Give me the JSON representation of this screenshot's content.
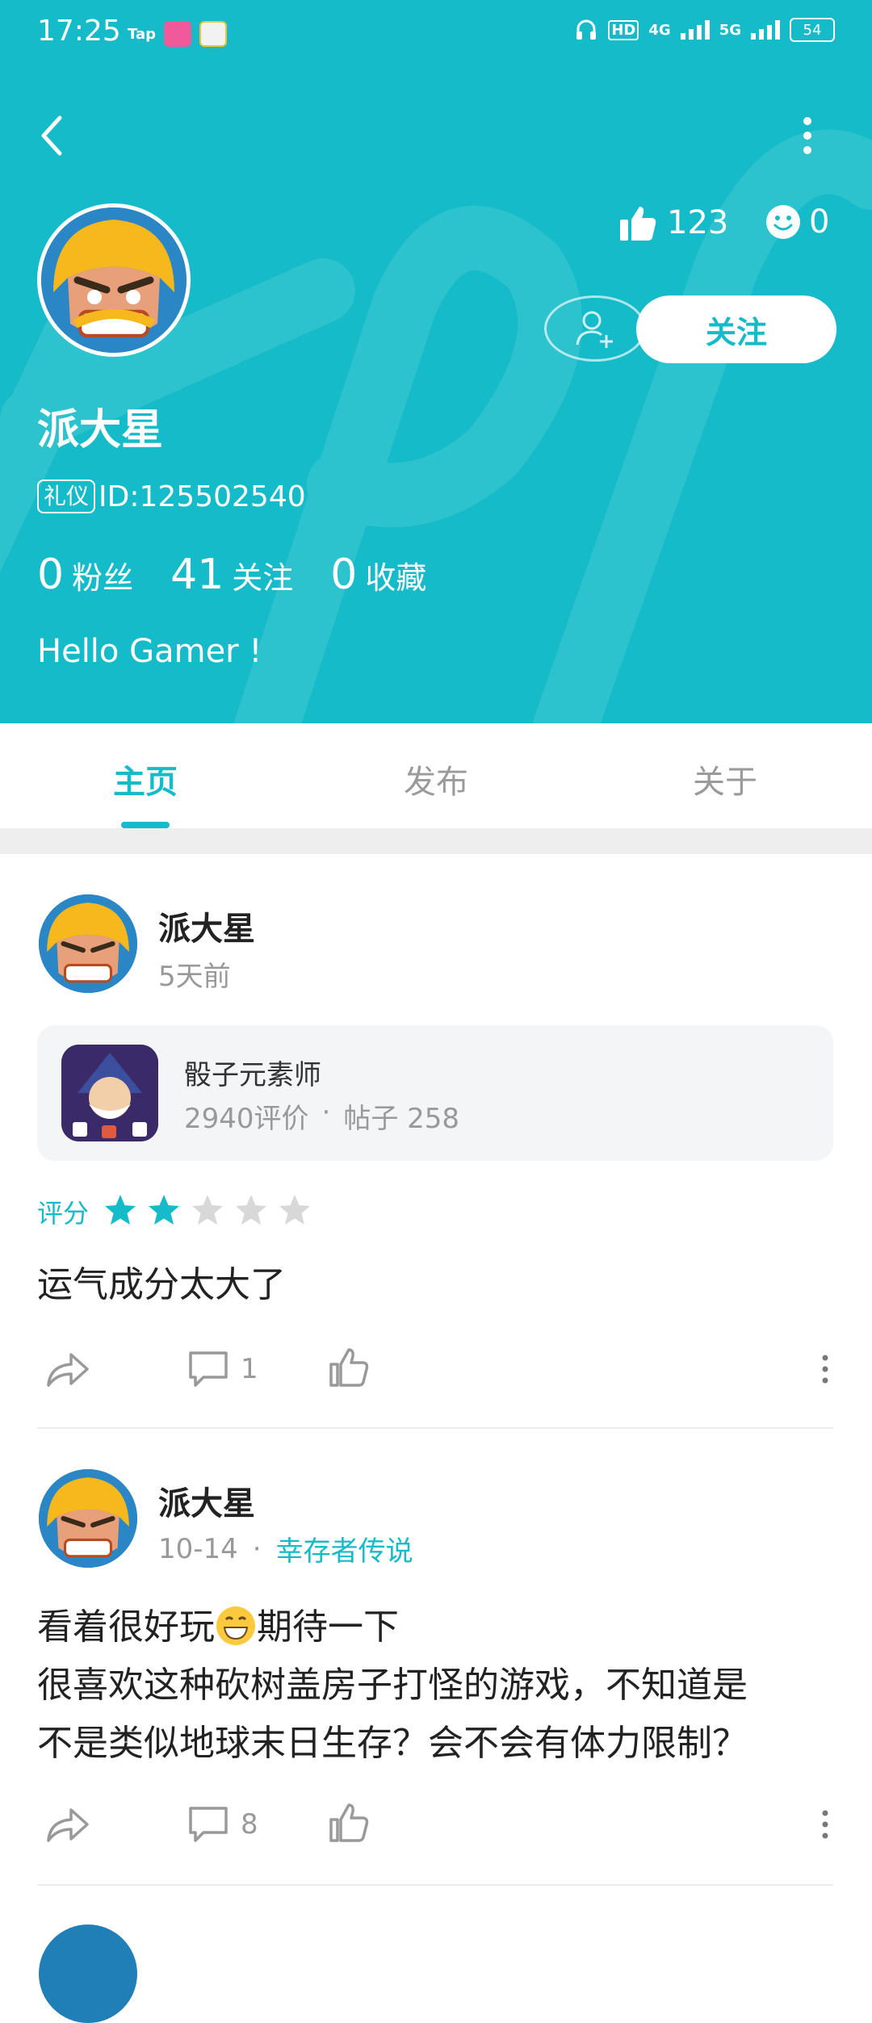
{
  "status_bar": {
    "time": "17:25",
    "app1": "Tap",
    "network_hd": "HD",
    "signal_4g": "4G",
    "signal_5g": "5G",
    "battery": "54"
  },
  "profile": {
    "likes": "123",
    "emoji_count": "0",
    "follow_label": "关注",
    "name": "派大星",
    "id_badge": "礼仪",
    "id_text": "ID:125502540",
    "fans_count": "0",
    "fans_label": "粉丝",
    "following_count": "41",
    "following_label": "关注",
    "favorites_count": "0",
    "favorites_label": "收藏",
    "bio": "Hello Gamer !"
  },
  "tabs": [
    {
      "label": "主页",
      "active": true
    },
    {
      "label": "发布",
      "active": false
    },
    {
      "label": "关于",
      "active": false
    }
  ],
  "posts": [
    {
      "author": "派大星",
      "time": "5天前",
      "game": {
        "name": "骰子元素师",
        "reviews": "2940评价",
        "dot": "·",
        "posts": "帖子 258"
      },
      "rating_label": "评分",
      "rating": 2,
      "rating_max": 5,
      "text": "运气成分太大了",
      "comments": "1"
    },
    {
      "author": "派大星",
      "time": "10-14",
      "dot": "·",
      "tag": "幸存者传说",
      "text_line1a": "看着很好玩",
      "text_line1b": "期待一下",
      "text_line2": "很喜欢这种砍树盖房子打怪的游戏，不知道是",
      "text_line3": "不是类似地球末日生存？会不会有体力限制？",
      "comments": "8"
    }
  ],
  "colors": {
    "accent": "#15bbc9",
    "star_off": "#d8d8d8"
  },
  "icons": [
    "back-icon",
    "more-icon",
    "thumb-up-icon",
    "smile-icon",
    "add-friend-icon",
    "share-icon",
    "comment-icon",
    "like-icon",
    "star-icon"
  ]
}
